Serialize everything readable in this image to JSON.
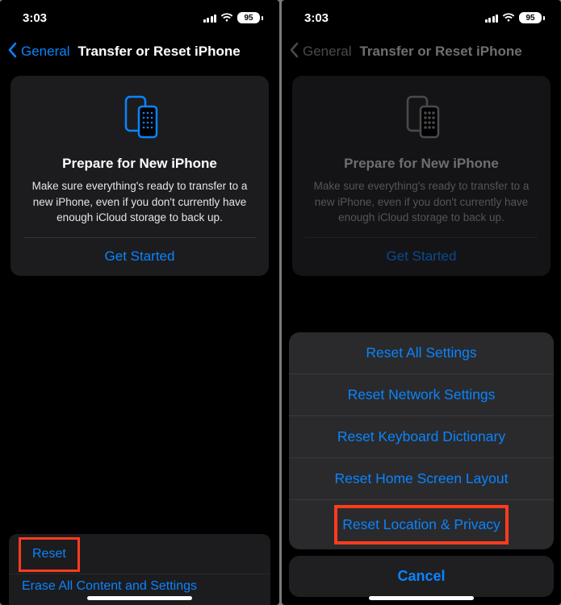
{
  "status": {
    "time": "3:03",
    "battery": "95"
  },
  "nav": {
    "back": "General",
    "title": "Transfer or Reset iPhone"
  },
  "card": {
    "title": "Prepare for New iPhone",
    "desc": "Make sure everything's ready to transfer to a new iPhone, even if you don't currently have enough iCloud storage to back up.",
    "action": "Get Started"
  },
  "list": {
    "reset": "Reset",
    "erase": "Erase All Content and Settings"
  },
  "sheet": {
    "items": [
      "Reset All Settings",
      "Reset Network Settings",
      "Reset Keyboard Dictionary",
      "Reset Home Screen Layout",
      "Reset Location & Privacy"
    ],
    "cancel": "Cancel"
  }
}
